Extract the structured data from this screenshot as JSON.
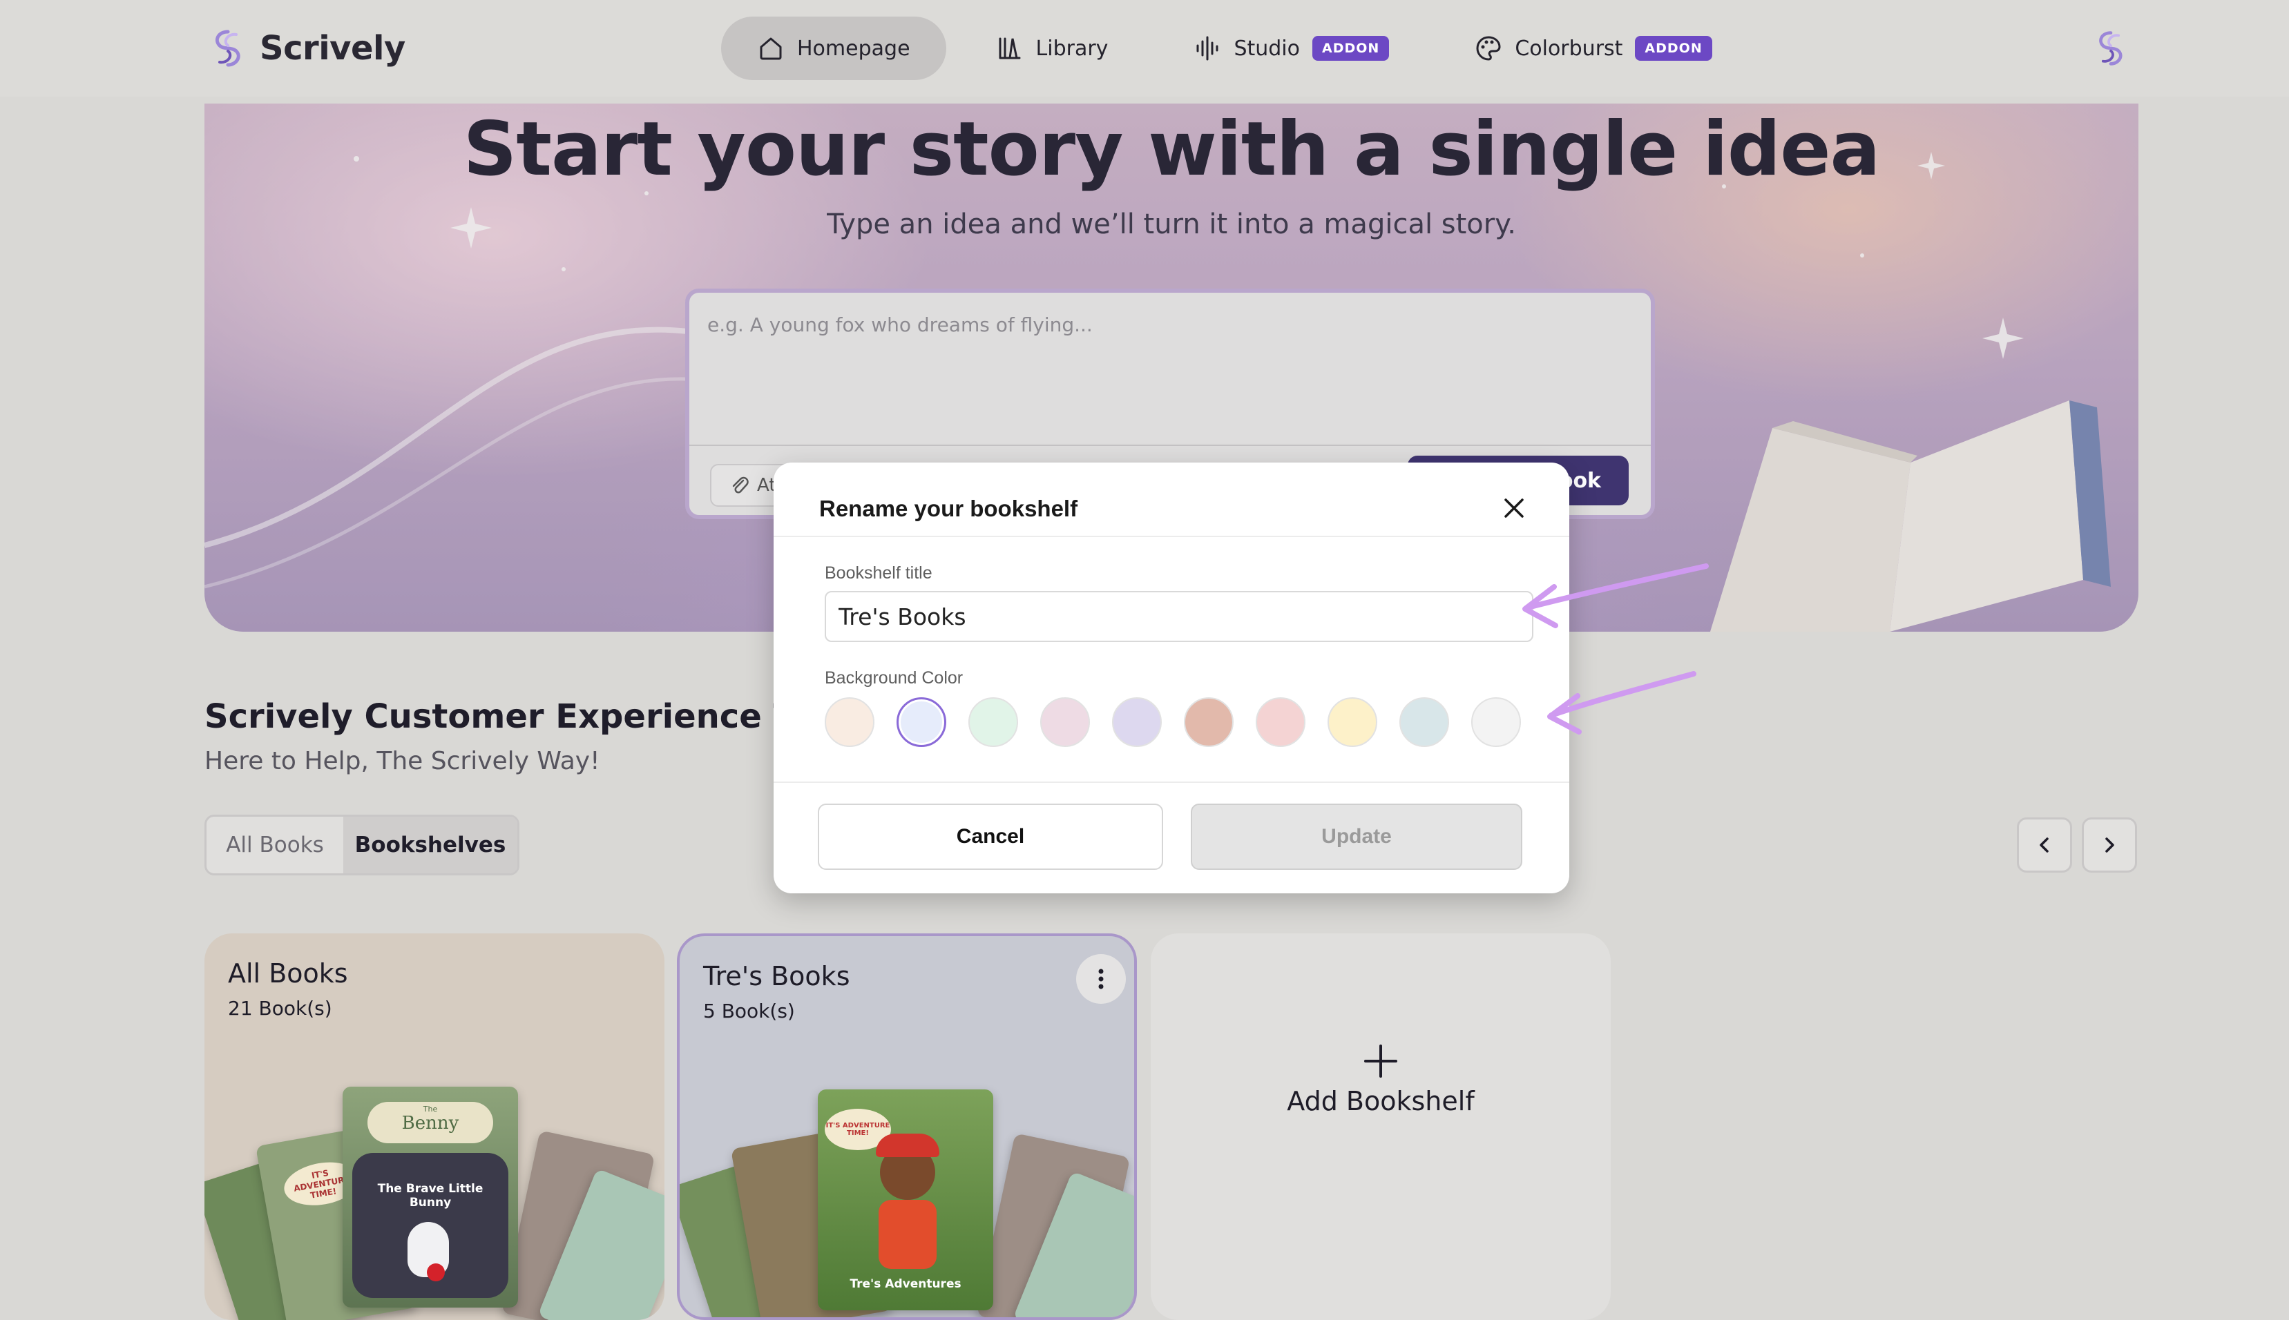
{
  "app": {
    "name": "Scrively"
  },
  "nav": {
    "tabs": [
      {
        "label": "Homepage",
        "icon": "home-icon",
        "active": true
      },
      {
        "label": "Library",
        "icon": "library-icon"
      },
      {
        "label": "Studio",
        "icon": "waveform-icon",
        "badge": "ADDON"
      },
      {
        "label": "Colorburst",
        "icon": "palette-icon",
        "badge": "ADDON"
      }
    ]
  },
  "hero": {
    "title": "Start your story with a single idea",
    "subtitle": "Type an idea and we’ll turn it into a magical story.",
    "prompt_placeholder": "e.g. A young fox who dreams of flying...",
    "attach_label": "At",
    "create_label": "ook"
  },
  "team": {
    "title": "Scrively Customer Experience Team",
    "subtitle": "Here to Help, The Scrively Way!",
    "view_options": [
      "All Books",
      "Bookshelves"
    ],
    "active_view": "Bookshelves"
  },
  "shelves": [
    {
      "title": "All Books",
      "count": "21 Book(s)",
      "cover_text": [
        "The",
        "Benny",
        "The Brave Little Bunny",
        "IT'S ADVENTURE TIME!"
      ]
    },
    {
      "title": "Tre's Books",
      "count": "5 Book(s)",
      "cover_text": [
        "IT'S ADVENTURE TIME!",
        "Tre's Adventures"
      ]
    }
  ],
  "add_shelf": {
    "label": "Add Bookshelf"
  },
  "modal": {
    "title": "Rename your bookshelf",
    "title_label": "Bookshelf title",
    "title_value": "Tre's Books",
    "color_label": "Background Color",
    "colors": [
      "#f9ece2",
      "#e6ecfb",
      "#e1f4e8",
      "#eedbe4",
      "#ddd8ef",
      "#e2b9ab",
      "#f4d3d3",
      "#fdf1c9",
      "#d8e6e9",
      "#f3f3f3"
    ],
    "selected_color_index": 1,
    "cancel_label": "Cancel",
    "update_label": "Update"
  },
  "colors": {
    "accent": "#6c48c4",
    "annotation_arrow": "#cf9af0"
  }
}
